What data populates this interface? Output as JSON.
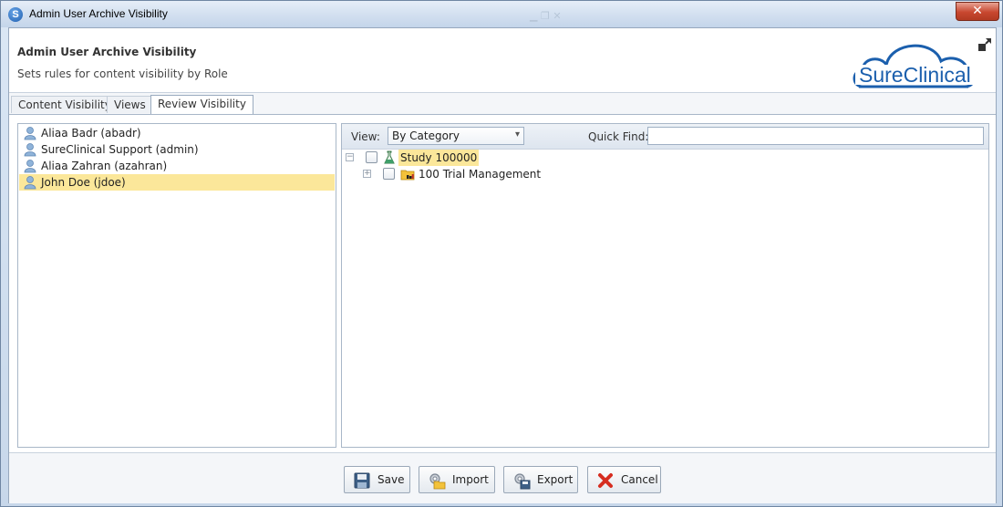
{
  "window": {
    "title": "Admin User Archive Visibility",
    "close_glyph": "✕"
  },
  "header": {
    "title": "Admin User Archive Visibility",
    "subtitle": "Sets rules for content visibility by Role",
    "logo_text": "SureClinical"
  },
  "tabs": [
    {
      "label": "Content Visibility",
      "active": false
    },
    {
      "label": "Views",
      "active": false
    },
    {
      "label": "Review Visibility",
      "active": true
    }
  ],
  "users": [
    {
      "label": "Aliaa Badr (abadr)",
      "selected": false
    },
    {
      "label": "SureClinical Support (admin)",
      "selected": false
    },
    {
      "label": "Aliaa Zahran (azahran)",
      "selected": false
    },
    {
      "label": "John Doe (jdoe)",
      "selected": true
    }
  ],
  "toolbar": {
    "view_label": "View:",
    "view_value": "By Category",
    "quick_find_label": "Quick Find:",
    "quick_find_value": ""
  },
  "tree": [
    {
      "label": "Study 100000",
      "icon": "flask-icon",
      "expanded": true,
      "level": 0
    },
    {
      "label": "100 Trial Management",
      "icon": "folder-icon",
      "expanded": false,
      "level": 1
    }
  ],
  "buttons": {
    "save": "Save",
    "import": "Import",
    "export": "Export",
    "cancel": "Cancel"
  },
  "colors": {
    "selection": "#fbe79a",
    "brand_blue": "#1b5fad",
    "cancel_red": "#d62d20"
  }
}
